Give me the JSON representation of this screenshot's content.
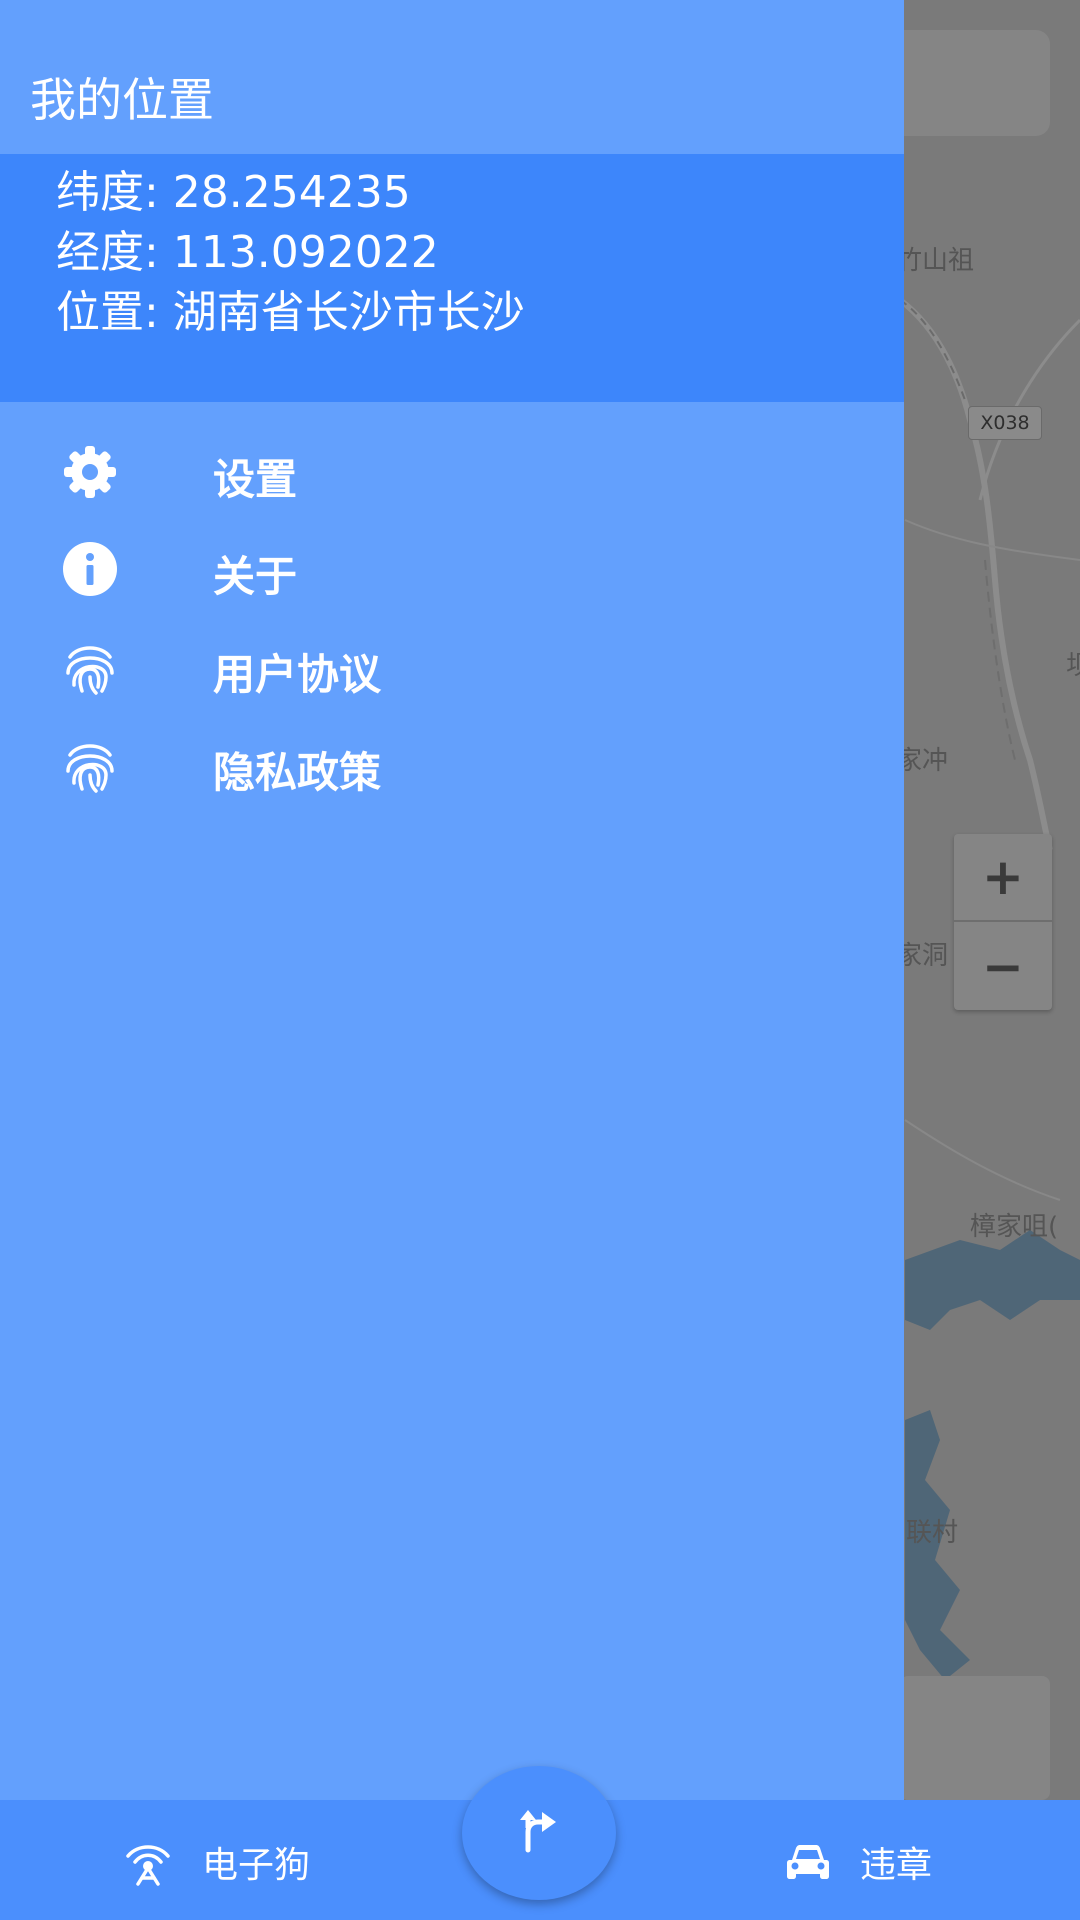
{
  "map": {
    "road_tag": "X038",
    "labels": [
      "竹山祖",
      "家冲",
      "家洞",
      "樟家咀(",
      "联村",
      "坝"
    ],
    "zoom_in": "+",
    "zoom_out": "−",
    "search_icon": "search-icon",
    "more_icon": "more-vert-icon",
    "locate_icon": "my-location-icon"
  },
  "drawer": {
    "title": "我的位置",
    "latitude": "纬度: 28.254235",
    "longitude": "经度: 113.092022",
    "location": "位置: 湖南省长沙市长沙",
    "menu": [
      {
        "label": "设置",
        "icon": "gear-icon"
      },
      {
        "label": "关于",
        "icon": "info-icon"
      },
      {
        "label": "用户协议",
        "icon": "fingerprint-icon"
      },
      {
        "label": "隐私政策",
        "icon": "fingerprint-icon"
      }
    ]
  },
  "bottom_nav": {
    "left_label": "电子狗",
    "left_icon": "radar-antenna-icon",
    "right_label": "违章",
    "right_icon": "car-icon",
    "fab_icon": "turn-right-icon"
  },
  "colors": {
    "drawer_bg": "#63a0fd",
    "header_bg": "#3d86fb",
    "bottom_bar": "#4b8ffd"
  }
}
